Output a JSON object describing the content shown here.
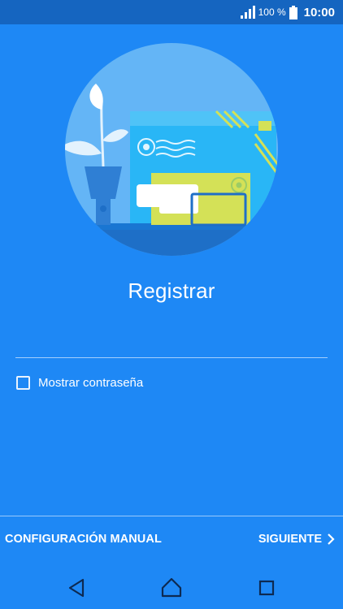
{
  "status_bar": {
    "battery_percent": "100 %",
    "time": "10:00",
    "icons": [
      "signal-icon",
      "battery-icon"
    ]
  },
  "screen": {
    "title": "Registrar",
    "show_password_label": "Mostrar contraseña",
    "show_password_checked": false
  },
  "footer": {
    "manual_label": "CONFIGURACIÓN MANUAL",
    "next_label": "SIGUIENTE"
  },
  "nav": {
    "icons": [
      "back-icon",
      "home-icon",
      "recent-apps-icon"
    ]
  },
  "colors": {
    "background": "#1e88f5",
    "status_bar": "#1565c0",
    "illustration_circle": "#64b5f6",
    "envelope_cyan": "#29b6f6",
    "envelope_lime": "#d4e157"
  }
}
